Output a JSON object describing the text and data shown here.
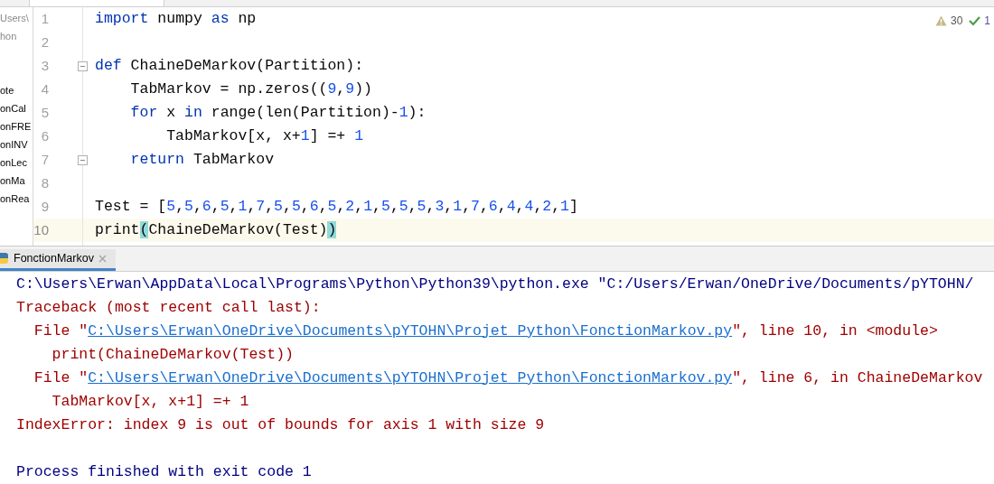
{
  "project_panel": {
    "path_rows": [
      "Users\\",
      "hon"
    ],
    "file_rows": [
      "ote",
      "onCal",
      "onFRE",
      "onINV",
      "onLec",
      "onMa",
      "onRea"
    ]
  },
  "inspections": {
    "warnings": "30",
    "checks": "1"
  },
  "editor": {
    "lines": [
      {
        "number": "1",
        "current": false,
        "fold": false,
        "tokens": [
          {
            "text": "import",
            "kind": "keyword"
          },
          {
            "text": " numpy ",
            "kind": "plain"
          },
          {
            "text": "as",
            "kind": "keyword"
          },
          {
            "text": " np",
            "kind": "plain"
          }
        ]
      },
      {
        "number": "2",
        "current": false,
        "fold": false
      },
      {
        "number": "3",
        "current": false,
        "fold": true,
        "tokens": [
          {
            "text": "def",
            "kind": "keyword"
          },
          {
            "text": " ChaineDeMarkov(Partition):",
            "kind": "plain"
          }
        ]
      },
      {
        "number": "4",
        "current": false,
        "fold": false,
        "tokens": [
          {
            "text": "    TabMarkov = np.zeros((",
            "kind": "plain"
          },
          {
            "text": "9",
            "kind": "number"
          },
          {
            "text": ",",
            "kind": "plain"
          },
          {
            "text": "9",
            "kind": "number"
          },
          {
            "text": "))",
            "kind": "plain"
          }
        ]
      },
      {
        "number": "5",
        "current": false,
        "fold": false,
        "tokens": [
          {
            "text": "    for",
            "kind": "keyword"
          },
          {
            "text": " x ",
            "kind": "plain"
          },
          {
            "text": "in",
            "kind": "keyword"
          },
          {
            "text": " range(len(Partition)-",
            "kind": "plain"
          },
          {
            "text": "1",
            "kind": "number"
          },
          {
            "text": "):",
            "kind": "plain"
          }
        ]
      },
      {
        "number": "6",
        "current": false,
        "fold": false,
        "tokens": [
          {
            "text": "        TabMarkov[x, x+",
            "kind": "plain"
          },
          {
            "text": "1",
            "kind": "number"
          },
          {
            "text": "] =+ ",
            "kind": "plain"
          },
          {
            "text": "1",
            "kind": "number"
          }
        ]
      },
      {
        "number": "7",
        "current": false,
        "fold": true,
        "tokens": [
          {
            "text": "    return",
            "kind": "keyword"
          },
          {
            "text": " TabMarkov",
            "kind": "plain"
          }
        ]
      },
      {
        "number": "8",
        "current": false,
        "fold": false
      },
      {
        "number": "9",
        "current": false,
        "fold": false,
        "tokens": [
          {
            "text": "Test = [",
            "kind": "plain"
          },
          {
            "text": "5",
            "kind": "number"
          },
          {
            "text": ",",
            "kind": "plain"
          },
          {
            "text": "5",
            "kind": "number"
          },
          {
            "text": ",",
            "kind": "plain"
          },
          {
            "text": "6",
            "kind": "number"
          },
          {
            "text": ",",
            "kind": "plain"
          },
          {
            "text": "5",
            "kind": "number"
          },
          {
            "text": ",",
            "kind": "plain"
          },
          {
            "text": "1",
            "kind": "number"
          },
          {
            "text": ",",
            "kind": "plain"
          },
          {
            "text": "7",
            "kind": "number"
          },
          {
            "text": ",",
            "kind": "plain"
          },
          {
            "text": "5",
            "kind": "number"
          },
          {
            "text": ",",
            "kind": "plain"
          },
          {
            "text": "5",
            "kind": "number"
          },
          {
            "text": ",",
            "kind": "plain"
          },
          {
            "text": "6",
            "kind": "number"
          },
          {
            "text": ",",
            "kind": "plain"
          },
          {
            "text": "5",
            "kind": "number"
          },
          {
            "text": ",",
            "kind": "plain"
          },
          {
            "text": "2",
            "kind": "number"
          },
          {
            "text": ",",
            "kind": "plain"
          },
          {
            "text": "1",
            "kind": "number"
          },
          {
            "text": ",",
            "kind": "plain"
          },
          {
            "text": "5",
            "kind": "number"
          },
          {
            "text": ",",
            "kind": "plain"
          },
          {
            "text": "5",
            "kind": "number"
          },
          {
            "text": ",",
            "kind": "plain"
          },
          {
            "text": "5",
            "kind": "number"
          },
          {
            "text": ",",
            "kind": "plain"
          },
          {
            "text": "3",
            "kind": "number"
          },
          {
            "text": ",",
            "kind": "plain"
          },
          {
            "text": "1",
            "kind": "number"
          },
          {
            "text": ",",
            "kind": "plain"
          },
          {
            "text": "7",
            "kind": "number"
          },
          {
            "text": ",",
            "kind": "plain"
          },
          {
            "text": "6",
            "kind": "number"
          },
          {
            "text": ",",
            "kind": "plain"
          },
          {
            "text": "4",
            "kind": "number"
          },
          {
            "text": ",",
            "kind": "plain"
          },
          {
            "text": "4",
            "kind": "number"
          },
          {
            "text": ",",
            "kind": "plain"
          },
          {
            "text": "2",
            "kind": "number"
          },
          {
            "text": ",",
            "kind": "plain"
          },
          {
            "text": "1",
            "kind": "number"
          },
          {
            "text": "]",
            "kind": "plain"
          }
        ]
      },
      {
        "number": "10",
        "current": true,
        "fold": false,
        "tokens": [
          {
            "text": "print",
            "kind": "plain"
          },
          {
            "text": "(",
            "kind": "brace-match"
          },
          {
            "text": "ChaineDeMarkov(Test)",
            "kind": "plain"
          },
          {
            "text": ")",
            "kind": "brace-match"
          }
        ]
      }
    ]
  },
  "run_tabs": [
    {
      "label": "FonctionMarkov",
      "selected": true
    }
  ],
  "console": {
    "output_lines": [
      [
        {
          "text": "C:\\Users\\Erwan\\AppData\\Local\\Programs\\Python\\Python39\\python.exe \"C:/Users/Erwan/OneDrive/Documents/pYTOHN/",
          "kind": "command"
        }
      ],
      [
        {
          "text": "Traceback (most recent call last):",
          "kind": "error"
        }
      ],
      [
        {
          "text": "  File \"",
          "kind": "error"
        },
        {
          "text": "C:\\Users\\Erwan\\OneDrive\\Documents\\pYTOHN\\Projet Python\\FonctionMarkov.py",
          "kind": "link"
        },
        {
          "text": "\", line 10, in <module>",
          "kind": "error"
        }
      ],
      [
        {
          "text": "    print(ChaineDeMarkov(Test))",
          "kind": "error"
        }
      ],
      [
        {
          "text": "  File \"",
          "kind": "error"
        },
        {
          "text": "C:\\Users\\Erwan\\OneDrive\\Documents\\pYTOHN\\Projet Python\\FonctionMarkov.py",
          "kind": "link"
        },
        {
          "text": "\", line 6, in ChaineDeMarkov",
          "kind": "error"
        }
      ],
      [
        {
          "text": "    TabMarkov[x, x+1] =+ 1",
          "kind": "error"
        }
      ],
      [
        {
          "text": "IndexError: index 9 is out of bounds for axis 1 with size 9",
          "kind": "error"
        }
      ]
    ],
    "exit_message": "Process finished with exit code 1"
  }
}
